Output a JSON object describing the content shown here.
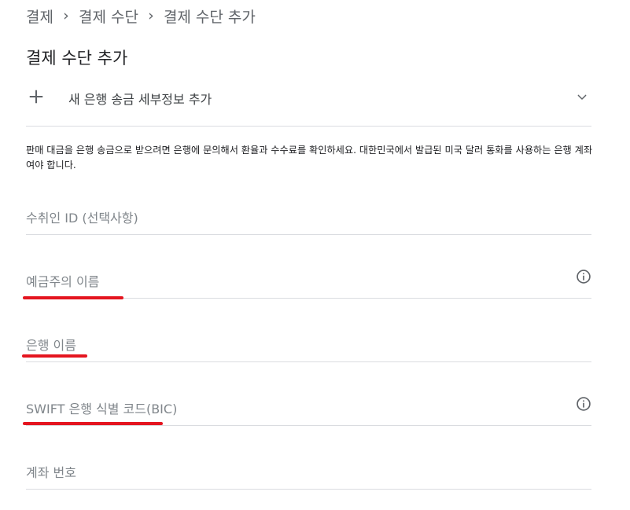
{
  "breadcrumb": {
    "items": [
      "결제",
      "결제 수단",
      "결제 수단 추가"
    ],
    "separator": "›"
  },
  "page_title": "결제 수단 추가",
  "add_bank": {
    "icon": "plus-icon",
    "label": "새 은행 송금 세부정보 추가",
    "expand_icon": "chevron-down-icon"
  },
  "info_text": "판매 대금을 은행 송금으로 받으려면 은행에 문의해서 환율과 수수료를 확인하세요. 대한민국에서 발급된 미국 달러 통화를 사용하는 은행 계좌여야 합니다.",
  "fields": {
    "payee_id": {
      "placeholder": "수취인 ID (선택사항)"
    },
    "account_holder": {
      "placeholder": "예금주의 이름",
      "info_icon": "info-icon"
    },
    "bank_name": {
      "placeholder": "은행 이름"
    },
    "swift": {
      "placeholder": "SWIFT 은행 식별 코드(BIC)",
      "info_icon": "info-icon"
    },
    "account_number": {
      "placeholder": "계좌 번호"
    }
  },
  "colors": {
    "highlight_underline": "#e4151f",
    "divider": "#dadce0",
    "placeholder": "#80868b"
  }
}
